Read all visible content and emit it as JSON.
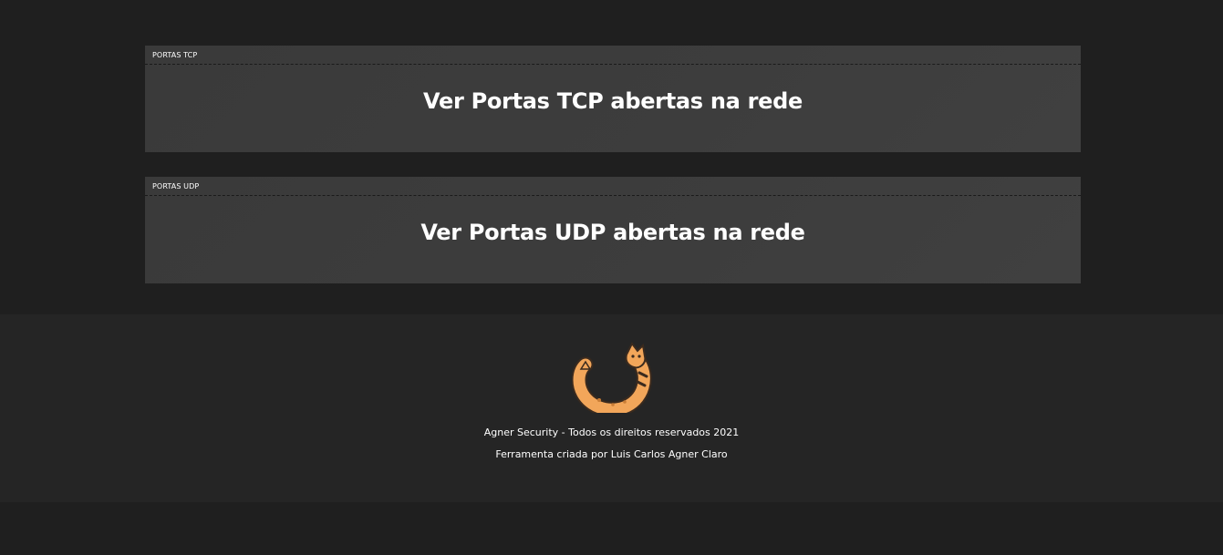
{
  "panels": {
    "tcp": {
      "header": "PORTAS TCP",
      "title": "Ver Portas TCP abertas na rede"
    },
    "udp": {
      "header": "PORTAS UDP",
      "title": "Ver Portas UDP abertas na rede"
    }
  },
  "footer": {
    "logo_icon": "fox-ring-logo-icon",
    "copyright": "Agner Security - Todos os direitos reservados 2021",
    "credit": "Ferramenta criada por Luis Carlos Agner Claro"
  },
  "colors": {
    "background": "#1f1f1f",
    "panel": "#3c3c3c",
    "footer": "#252525",
    "logo_orange": "#f2a65a"
  }
}
